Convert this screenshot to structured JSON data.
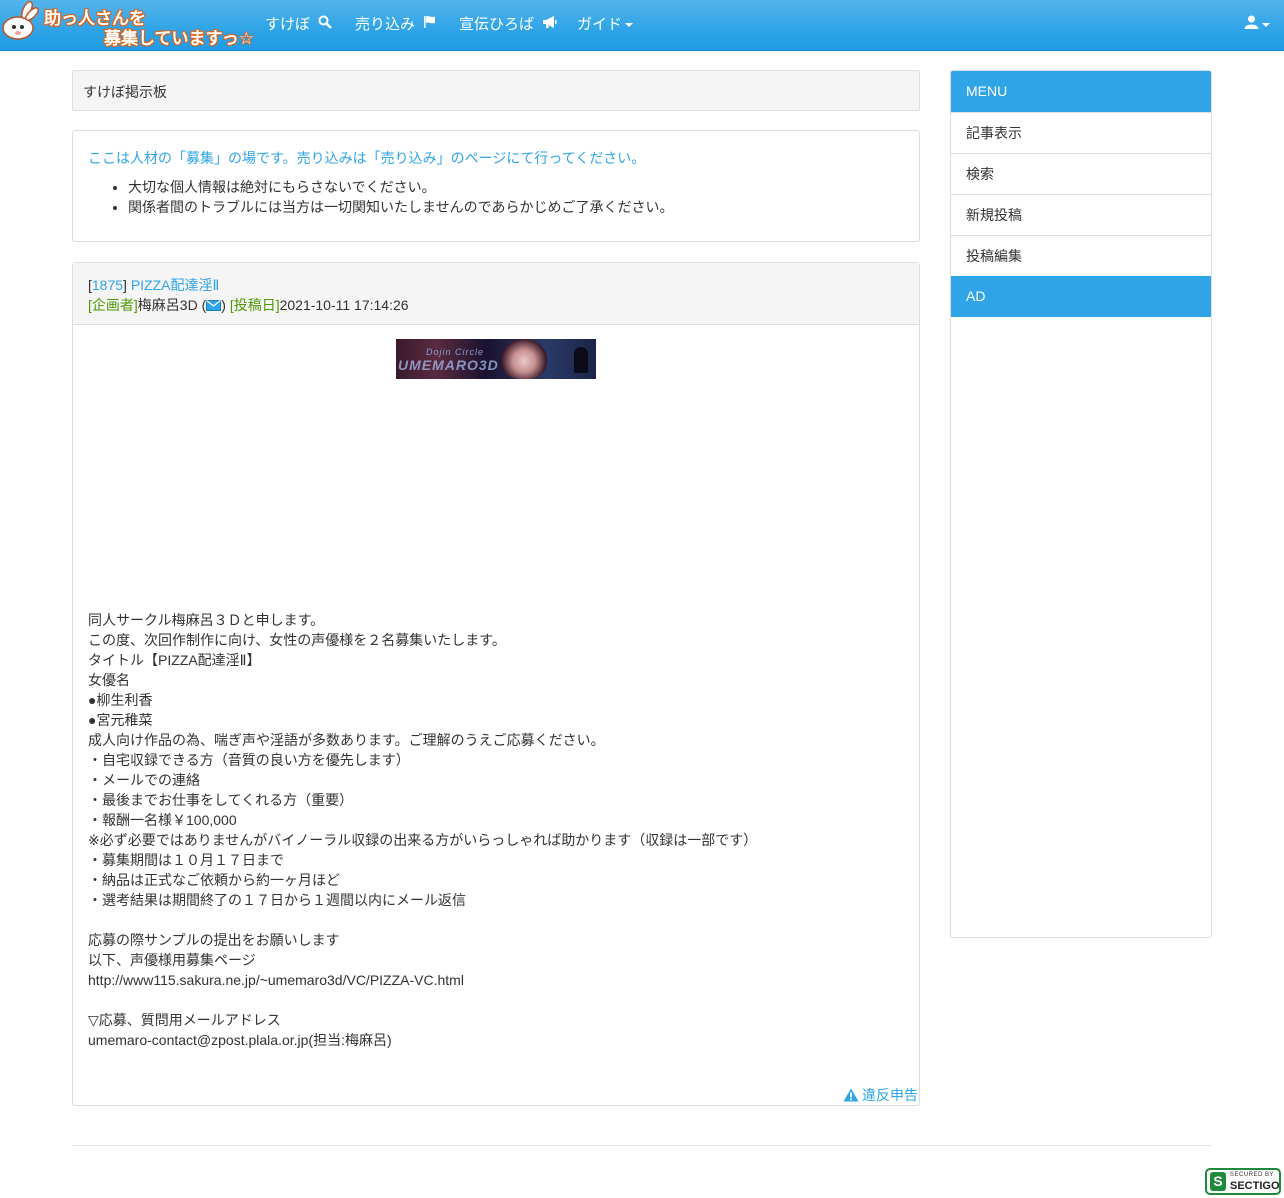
{
  "navbar": {
    "brand_line1": "助っ人さんを",
    "brand_line2": "募集していますっ☆",
    "items": [
      {
        "label": "すけぼ",
        "icon": "search-icon"
      },
      {
        "label": "売り込み",
        "icon": "flag-icon"
      },
      {
        "label": "宣伝ひろば",
        "icon": "bullhorn-icon"
      },
      {
        "label": "ガイド",
        "icon": "caret-down-icon"
      }
    ],
    "user_icon": "user-icon"
  },
  "breadcrumb": "すけぼ掲示板",
  "notice": {
    "lead": "ここは人材の「募集」の場です。売り込みは「売り込み」のページにて行ってください。",
    "rules": [
      "大切な個人情報は絶対にもらさないでください。",
      "関係者間のトラブルには当方は一切関知いたしませんのであらかじめご了承ください。"
    ]
  },
  "post": {
    "id": "1875",
    "title": "PIZZA配達淫Ⅱ",
    "planner_label": "企画者",
    "planner": "梅麻呂3D",
    "date_label": "投稿日",
    "date": "2021-10-11 17:14:26",
    "banner_small": "Dojin Circle",
    "banner_big": "UMEMARO3D",
    "body": [
      "同人サークル梅麻呂３Ｄと申します。",
      "この度、次回作制作に向け、女性の声優様を２名募集いたします。",
      "タイトル【PIZZA配達淫Ⅱ】",
      "女優名",
      "●柳生利香",
      "●宮元稚菜",
      "成人向け作品の為、喘ぎ声や淫語が多数あります。ご理解のうえご応募ください。",
      "・自宅収録できる方（音質の良い方を優先します）",
      "・メールでの連絡",
      "・最後までお仕事をしてくれる方（重要）",
      "・報酬一名様￥100,000",
      "※必ず必要ではありませんがバイノーラル収録の出来る方がいらっしゃれば助かります（収録は一部です）",
      "・募集期間は１０月１７日まで",
      "・納品は正式なご依頼から約一ヶ月ほど",
      "・選考結果は期間終了の１７日から１週間以内にメール返信",
      "",
      "応募の際サンプルの提出をお願いします",
      "以下、声優様用募集ページ",
      "http://www115.sakura.ne.jp/~umemaro3d/VC/PIZZA-VC.html",
      "",
      "▽応募、質問用メールアドレス",
      "umemaro-contact@zpost.plala.or.jp(担当:梅麻呂)"
    ],
    "report_label": "違反申告"
  },
  "sidebar": {
    "menu_title": "MENU",
    "items": [
      "記事表示",
      "検索",
      "新規投稿",
      "投稿編集"
    ],
    "ad_title": "AD"
  },
  "badge": {
    "line1": "SECURED BY",
    "line2": "SECTIGO"
  },
  "colors": {
    "primary": "#2fa4e7",
    "label_green": "#4e9a06",
    "panel_bg": "#f5f5f5"
  }
}
